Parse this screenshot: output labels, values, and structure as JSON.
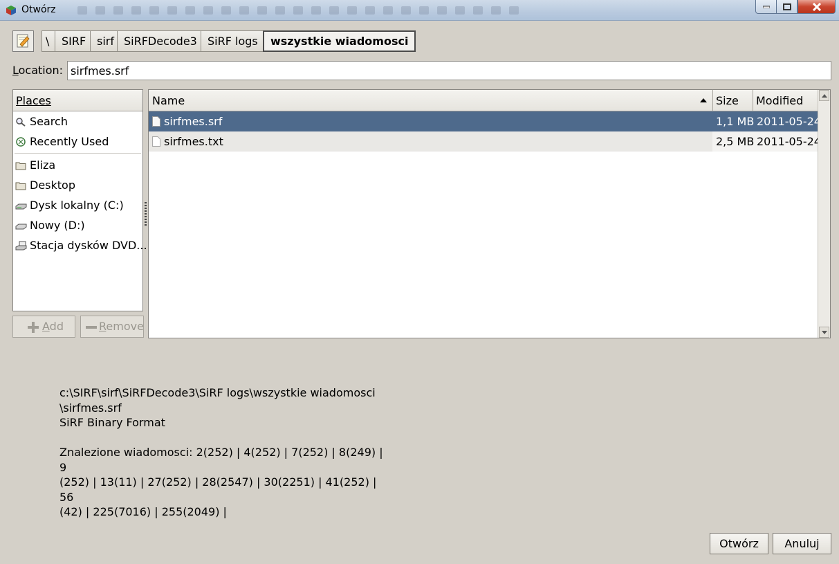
{
  "window": {
    "title": "Otwórz",
    "close_icon": "close-icon",
    "minimize_icon": "minimize-icon",
    "maximize_icon": "maximize-icon"
  },
  "breadcrumb": {
    "toggle_icon": "edit-pencil-icon",
    "items": [
      "\\",
      "SIRF",
      "sirf",
      "SiRFDecode3",
      "SiRF logs",
      "wszystkie wiadomosci"
    ],
    "active_index": 5
  },
  "location": {
    "label_underlined": "L",
    "label_rest": "ocation:",
    "value": "sirfmes.srf"
  },
  "places": {
    "header": "Places",
    "items": [
      {
        "label": "Search",
        "icon": "magnifier-icon"
      },
      {
        "label": "Recently Used",
        "icon": "recent-clock-icon"
      },
      {
        "label": "Eliza",
        "icon": "folder-icon"
      },
      {
        "label": "Desktop",
        "icon": "folder-icon"
      },
      {
        "label": "Dysk lokalny (C:)",
        "icon": "harddisk-icon"
      },
      {
        "label": "Nowy (D:)",
        "icon": "harddisk-icon"
      },
      {
        "label": "Stacja dysków DVD...",
        "icon": "dvd-drive-icon"
      }
    ],
    "add_label_u": "A",
    "add_label_rest": "dd",
    "remove_label_u": "R",
    "remove_label_rest": "emove"
  },
  "files": {
    "columns": {
      "name": "Name",
      "size": "Size",
      "modified": "Modified"
    },
    "rows": [
      {
        "name": "sirfmes.srf",
        "size": "1,1 MB",
        "modified": "2011-05-24",
        "selected": true
      },
      {
        "name": "sirfmes.txt",
        "size": "2,5 MB",
        "modified": "2011-05-24",
        "selected": false
      }
    ]
  },
  "preview": {
    "line1": "c:\\SIRF\\sirf\\SiRFDecode3\\SiRF logs\\wszystkie wiadomosci",
    "line2": "\\sirfmes.srf",
    "line3": "SiRF Binary Format",
    "line4": "Znalezione wiadomosci: 2(252) | 4(252) | 7(252) | 8(249) | 9",
    "line5": "(252) | 13(11) | 27(252) | 28(2547) | 30(2251) | 41(252) | 56",
    "line6": "(42) | 225(7016) | 255(2049) |"
  },
  "buttons": {
    "open": "Otwórz",
    "cancel": "Anuluj"
  },
  "colors": {
    "selection": "#4e6a8c",
    "dialog_bg": "#d4d0c8"
  }
}
